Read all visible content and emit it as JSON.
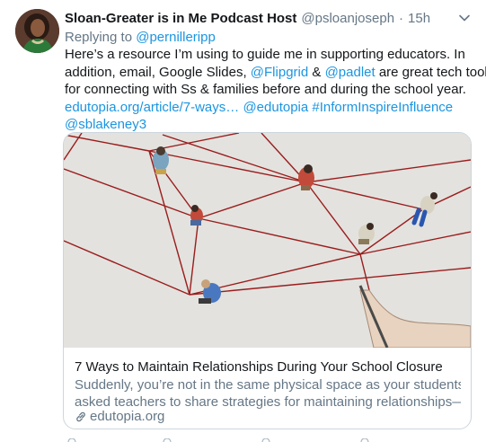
{
  "tweet": {
    "display_name": "Sloan-Greater is in Me Podcast Host",
    "handle": "@psloanjoseph",
    "separator": "·",
    "time": "15h",
    "reply_prefix": "Replying to ",
    "reply_to": "@pernilleripp",
    "body": {
      "l1": "Here’s a resource I’m using to guide me in supporting educators. In",
      "l2a": "addition, email, Google Slides, ",
      "l2_mention1": "@Flipgrid",
      "l2b": " & ",
      "l2_mention2": "@padlet",
      "l2c": " are great tech tools",
      "l3": "for connecting with Ss & families before and during the school year.",
      "l4_link": "edutopia.org/article/7-ways…",
      "l4_sp1": " ",
      "l4_mention": "@edutopia",
      "l4_sp2": " ",
      "l4_hashtag": "#InformInspireInfluence",
      "l5_mention": "@sblakeney3"
    }
  },
  "card": {
    "title": "7 Ways to Maintain Relationships During Your School Closure",
    "desc_l1": "Suddenly, you’re not in the same physical space as your students. We",
    "desc_l2": "asked teachers to share strategies for maintaining relationships—bot…",
    "domain": "edutopia.org"
  },
  "colors": {
    "link": "#1b95e0",
    "secondary_text": "#657786",
    "border": "#ccd6dd",
    "string": "#9a1d1d"
  },
  "icons": {
    "caret": "chevron-down-icon",
    "link": "link-icon"
  }
}
